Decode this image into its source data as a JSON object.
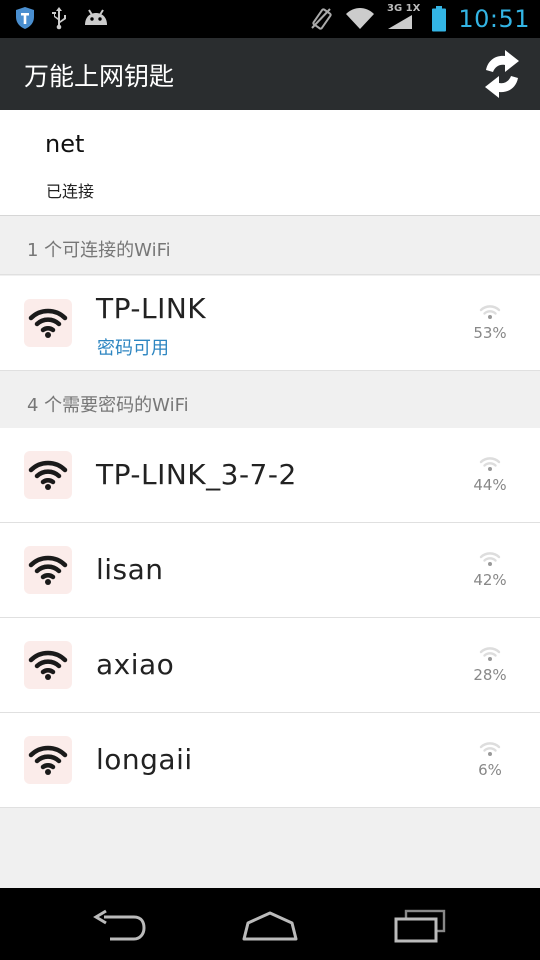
{
  "status_bar": {
    "time": "10:51",
    "network_type_top": "3G",
    "network_type_bottom": "1X"
  },
  "app_bar": {
    "title": "万能上网钥匙"
  },
  "connected": {
    "ssid": "net",
    "state": "已连接"
  },
  "sections": [
    {
      "header": "1 个可连接的WiFi",
      "networks": [
        {
          "ssid": "TP-LINK",
          "note": "密码可用",
          "signal": "53%"
        }
      ]
    },
    {
      "header": "4 个需要密码的WiFi",
      "networks": [
        {
          "ssid": "TP-LINK_3-7-2",
          "signal": "44%"
        },
        {
          "ssid": "lisan",
          "signal": "42%"
        },
        {
          "ssid": "axiao",
          "signal": "28%"
        },
        {
          "ssid": "longaii",
          "signal": "6%"
        }
      ]
    }
  ],
  "colors": {
    "status_accent": "#33b5e5",
    "action_bar": "#2a2d2f",
    "note_blue": "#2e86c1",
    "icon_tile": "#fbecea"
  }
}
